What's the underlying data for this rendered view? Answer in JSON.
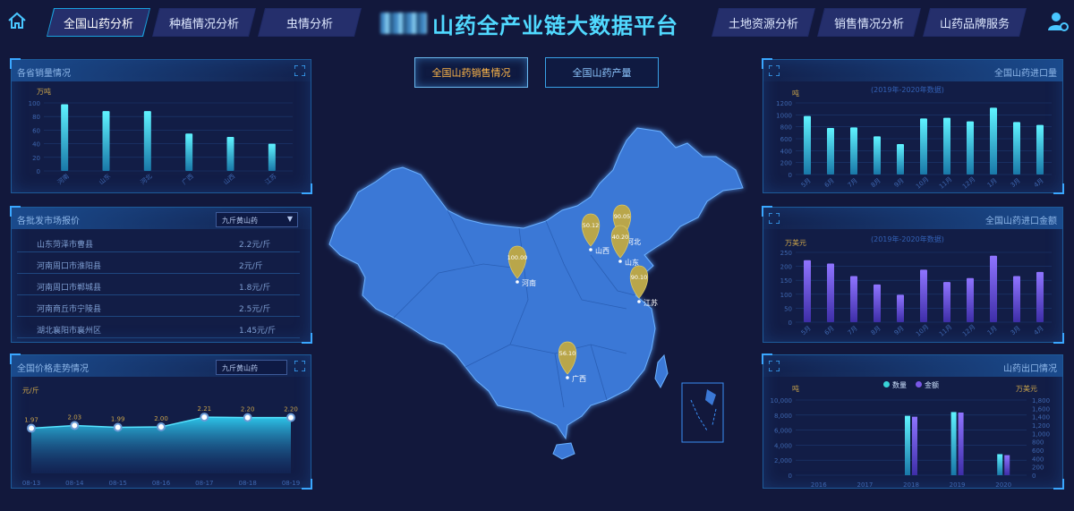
{
  "header": {
    "title": "山药全产业链大数据平台",
    "left_tabs": [
      "全国山药分析",
      "种植情况分析",
      "虫情分析"
    ],
    "right_tabs": [
      "土地资源分析",
      "销售情况分析",
      "山药品牌服务"
    ],
    "active_tab": "全国山药分析"
  },
  "center": {
    "buttons": [
      "全国山药销售情况",
      "全国山药产量"
    ],
    "active_button": "全国山药销售情况",
    "map_markers": [
      {
        "name": "河北",
        "value": "90.05"
      },
      {
        "name": "山西",
        "value": "50.12"
      },
      {
        "name": "山东",
        "value": "40.20"
      },
      {
        "name": "河南",
        "value": "100.00"
      },
      {
        "name": "江苏",
        "value": "90.10"
      },
      {
        "name": "广西",
        "value": "56.10"
      }
    ]
  },
  "left": {
    "sales_panel": {
      "title": "各省销量情况",
      "unit": "万吨"
    },
    "price_panel": {
      "title": "各批发市场报价",
      "dropdown": "九斤黄山药",
      "rows": [
        {
          "name": "山东菏泽市曹县",
          "price": "2.2元/斤"
        },
        {
          "name": "河南周口市淮阳县",
          "price": "2元/斤"
        },
        {
          "name": "河南周口市郸城县",
          "price": "1.8元/斤"
        },
        {
          "name": "河南商丘市宁陵县",
          "price": "2.5元/斤"
        },
        {
          "name": "湖北襄阳市襄州区",
          "price": "1.45元/斤"
        }
      ]
    },
    "trend_panel": {
      "title": "全国价格走势情况",
      "dropdown": "九斤黄山药",
      "unit": "元/斤"
    }
  },
  "right": {
    "import_qty_panel": {
      "title": "全国山药进口量",
      "subtitle": "(2019年-2020年数据)",
      "unit": "吨"
    },
    "import_amt_panel": {
      "title": "全国山药进口金额",
      "subtitle": "(2019年-2020年数据)",
      "unit": "万美元"
    },
    "export_panel": {
      "title": "山药出口情况",
      "unit_left": "吨",
      "unit_right": "万美元",
      "legend": [
        "数量",
        "金额"
      ]
    }
  },
  "chart_data": [
    {
      "type": "bar",
      "title": "各省销量情况",
      "ylabel": "万吨",
      "categories": [
        "河南",
        "山东",
        "河北",
        "广西",
        "山西",
        "江苏"
      ],
      "values": [
        98,
        88,
        88,
        55,
        50,
        40
      ],
      "ylim": [
        0,
        100
      ],
      "yticks": [
        0,
        20,
        40,
        60,
        80,
        100
      ]
    },
    {
      "type": "line",
      "title": "全国价格走势情况",
      "ylabel": "元/斤",
      "x": [
        "08-13",
        "08-14",
        "08-15",
        "08-16",
        "08-17",
        "08-18",
        "08-19"
      ],
      "values": [
        1.97,
        2.03,
        1.99,
        2.0,
        2.21,
        2.2,
        2.2
      ],
      "value_labels": [
        "1.97",
        "2.03",
        "1.99",
        "2.00",
        "2.21",
        "2.20",
        "2.20"
      ],
      "ylim": [
        0,
        2.5
      ]
    },
    {
      "type": "bar",
      "title": "全国山药进口量",
      "ylabel": "吨",
      "categories": [
        "5月",
        "6月",
        "7月",
        "8月",
        "9月",
        "10月",
        "11月",
        "12月",
        "1月",
        "3月",
        "4月"
      ],
      "values": [
        980,
        780,
        790,
        640,
        510,
        940,
        950,
        890,
        1120,
        880,
        830
      ],
      "ylim": [
        0,
        1200
      ],
      "yticks": [
        0,
        200,
        400,
        600,
        800,
        1000,
        1200
      ]
    },
    {
      "type": "bar",
      "title": "全国山药进口金额",
      "ylabel": "万美元",
      "categories": [
        "5月",
        "6月",
        "7月",
        "8月",
        "9月",
        "10月",
        "11月",
        "12月",
        "1月",
        "3月",
        "4月"
      ],
      "values": [
        222,
        210,
        165,
        135,
        98,
        188,
        144,
        158,
        238,
        165,
        180
      ],
      "ylim": [
        0,
        250
      ],
      "yticks": [
        0,
        50,
        100,
        150,
        200,
        250
      ]
    },
    {
      "type": "bar",
      "title": "山药出口情况",
      "categories": [
        "2016",
        "2017",
        "2018",
        "2019",
        "2020"
      ],
      "series": [
        {
          "name": "数量",
          "values": [
            0,
            0,
            7900,
            8400,
            2800
          ]
        },
        {
          "name": "金额",
          "values": [
            0,
            0,
            1400,
            1500,
            480
          ]
        }
      ],
      "ylim_left": [
        0,
        10000
      ],
      "ylim_right": [
        0,
        1800
      ],
      "yticks_left": [
        "0",
        "2,000",
        "4,000",
        "6,000",
        "8,000",
        "10,000"
      ],
      "yticks_right": [
        "0",
        "200",
        "400",
        "600",
        "800",
        "1,000",
        "1,200",
        "1,400",
        "1,600",
        "1,800"
      ]
    }
  ]
}
